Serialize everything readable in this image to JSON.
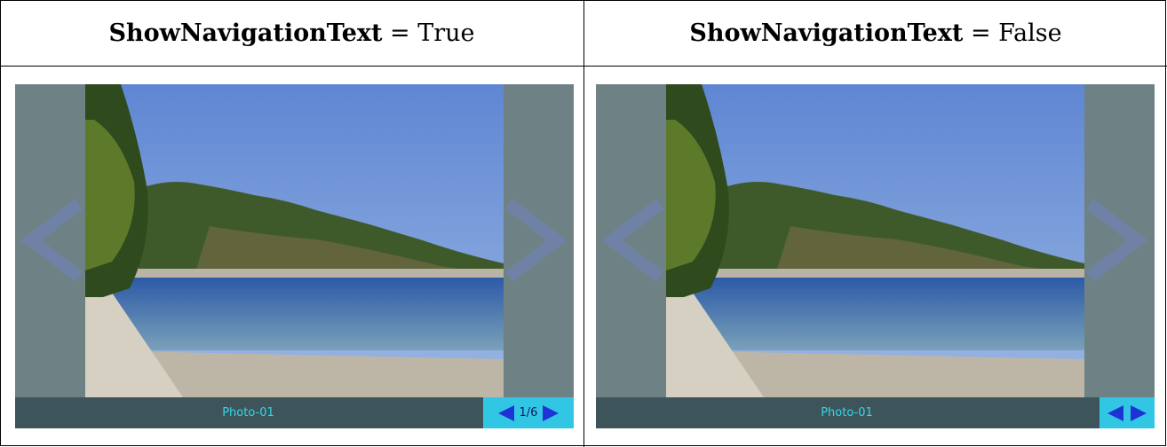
{
  "left_panel": {
    "header_prop": "ShowNavigationText",
    "header_eq": " = True",
    "caption": "Photo-01",
    "nav_text": "1/6"
  },
  "right_panel": {
    "header_prop": "ShowNavigationText",
    "header_eq": " = False",
    "caption": "Photo-01"
  },
  "colors": {
    "nav_zone": "#6e8285",
    "footer": "#3e545b",
    "caption_text": "#33d8e8",
    "nav_box": "#31c7e4",
    "nav_arrow": "#1e33d6"
  },
  "icons": [
    "arrow-left-icon",
    "arrow-right-icon",
    "prev-triangle-icon",
    "next-triangle-icon"
  ]
}
